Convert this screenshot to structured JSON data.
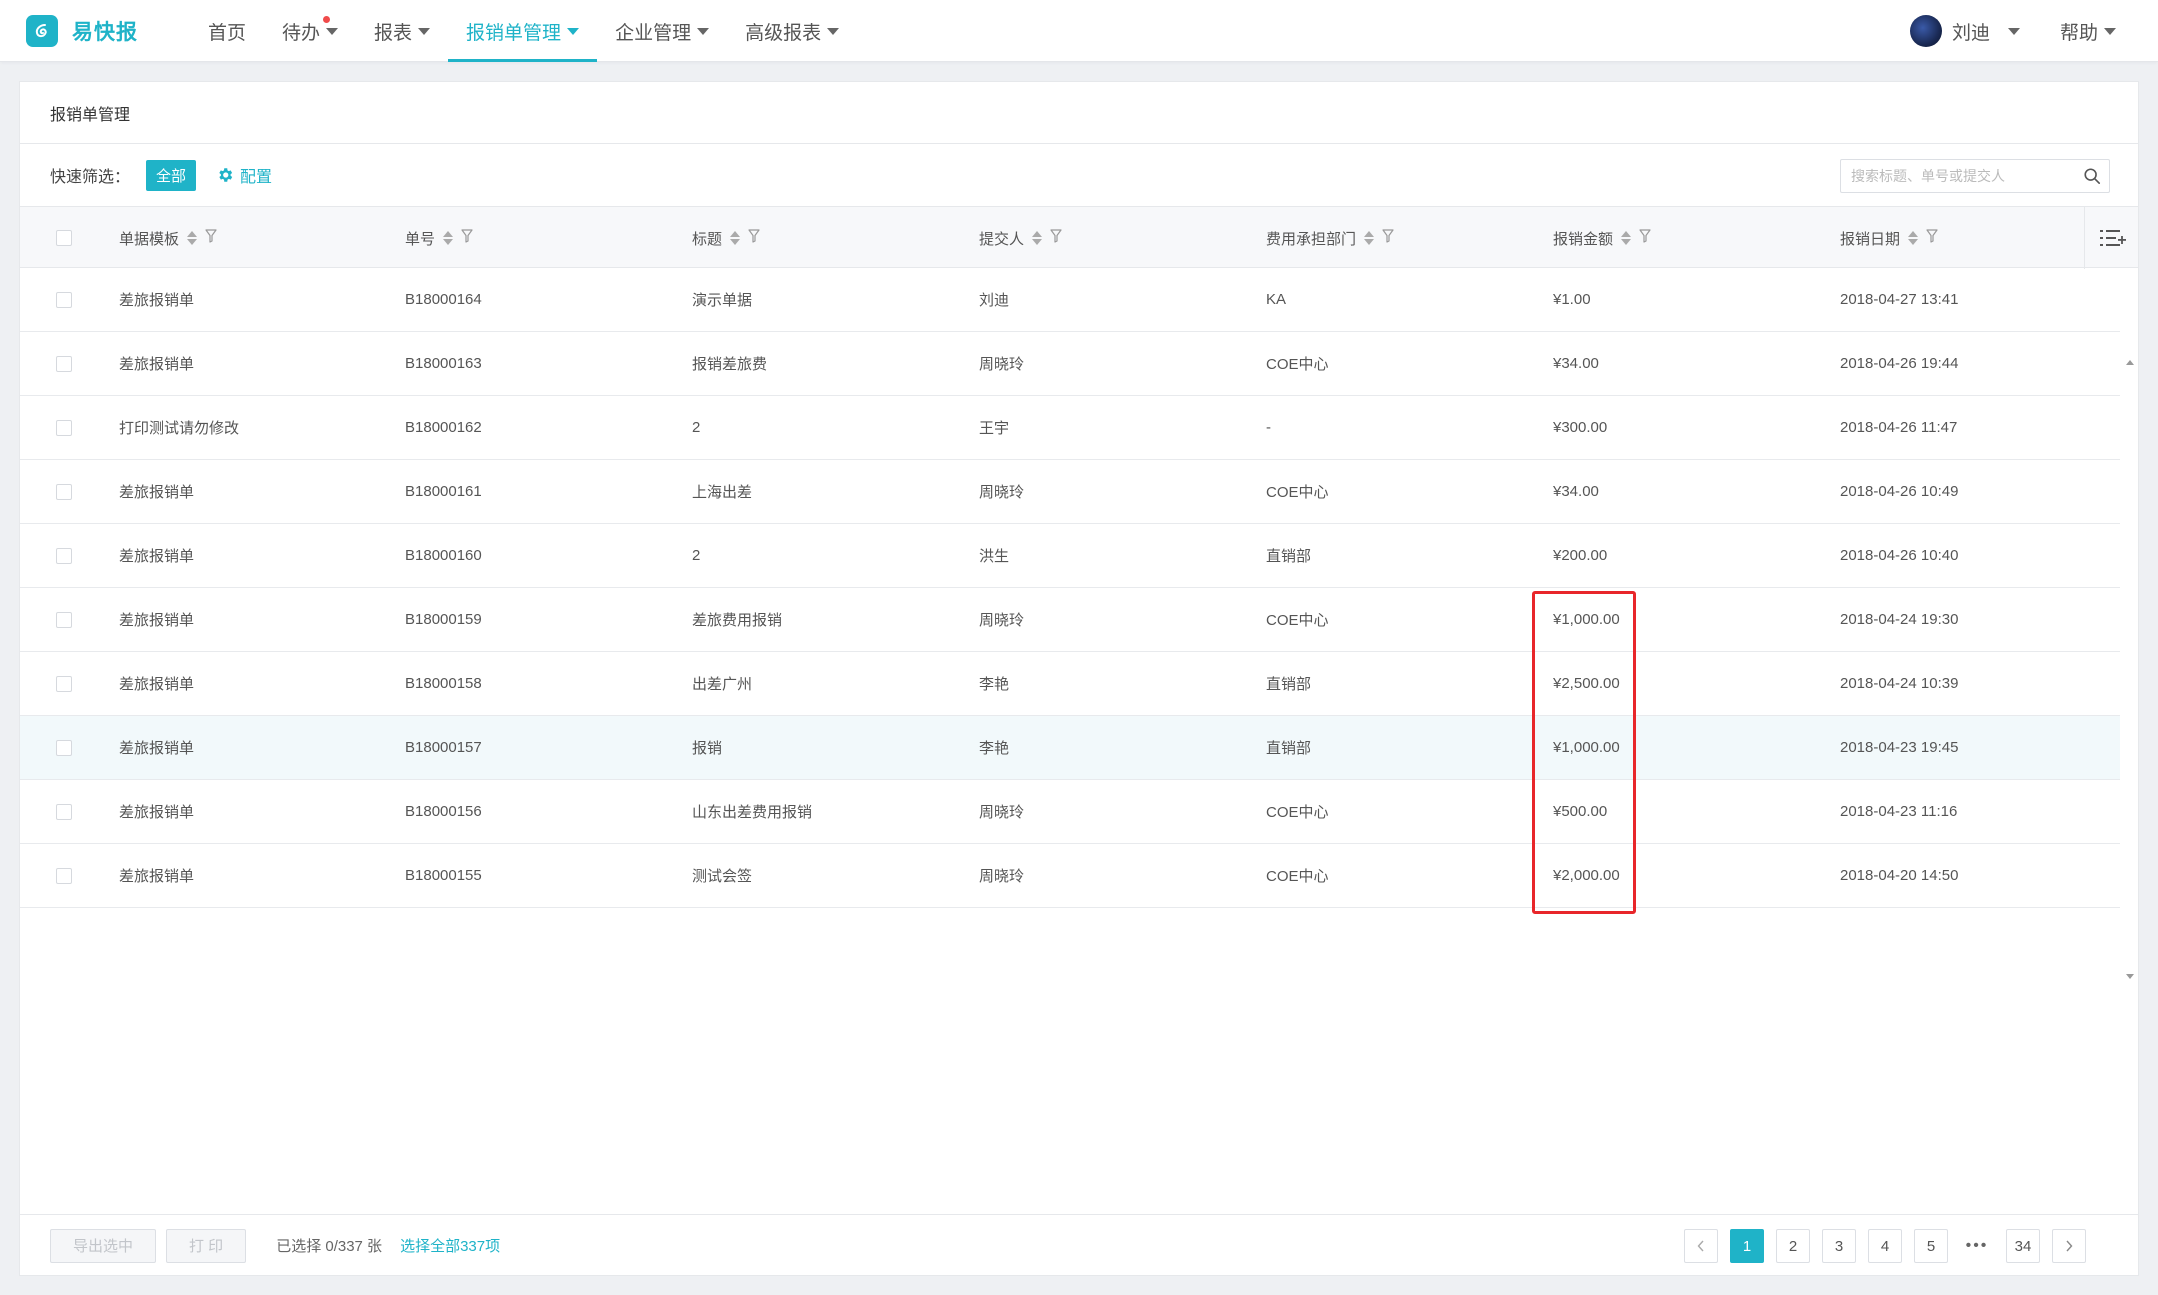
{
  "app": {
    "name": "易快报"
  },
  "nav": {
    "items": [
      {
        "label": "首页",
        "has_caret": false
      },
      {
        "label": "待办",
        "has_caret": true,
        "has_notice": true
      },
      {
        "label": "报表",
        "has_caret": true
      },
      {
        "label": "报销单管理",
        "has_caret": true,
        "active": true
      },
      {
        "label": "企业管理",
        "has_caret": true
      },
      {
        "label": "高级报表",
        "has_caret": true
      }
    ]
  },
  "user": {
    "name": "刘迪"
  },
  "help": {
    "label": "帮助"
  },
  "panel": {
    "title": "报销单管理"
  },
  "filter": {
    "label": "快速筛选：",
    "all_label": "全部",
    "config_label": "配置",
    "search_placeholder": "搜索标题、单号或提交人"
  },
  "table": {
    "columns": [
      "单据模板",
      "单号",
      "标题",
      "提交人",
      "费用承担部门",
      "报销金额",
      "报销日期"
    ],
    "rows": [
      [
        "差旅报销单",
        "B18000164",
        "演示单据",
        "刘迪",
        "KA",
        "¥1.00",
        "2018-04-27 13:41"
      ],
      [
        "差旅报销单",
        "B18000163",
        "报销差旅费",
        "周晓玲",
        "COE中心",
        "¥34.00",
        "2018-04-26 19:44"
      ],
      [
        "打印测试请勿修改",
        "B18000162",
        "2",
        "王宇",
        "-",
        "¥300.00",
        "2018-04-26 11:47"
      ],
      [
        "差旅报销单",
        "B18000161",
        "上海出差",
        "周晓玲",
        "COE中心",
        "¥34.00",
        "2018-04-26 10:49"
      ],
      [
        "差旅报销单",
        "B18000160",
        "2",
        "洪生",
        "直销部",
        "¥200.00",
        "2018-04-26 10:40"
      ],
      [
        "差旅报销单",
        "B18000159",
        "差旅费用报销",
        "周晓玲",
        "COE中心",
        "¥1,000.00",
        "2018-04-24 19:30"
      ],
      [
        "差旅报销单",
        "B18000158",
        "出差广州",
        "李艳",
        "直销部",
        "¥2,500.00",
        "2018-04-24 10:39"
      ],
      [
        "差旅报销单",
        "B18000157",
        "报销",
        "李艳",
        "直销部",
        "¥1,000.00",
        "2018-04-23 19:45"
      ],
      [
        "差旅报销单",
        "B18000156",
        "山东出差费用报销",
        "周晓玲",
        "COE中心",
        "¥500.00",
        "2018-04-23 11:16"
      ],
      [
        "差旅报销单",
        "B18000155",
        "测试会签",
        "周晓玲",
        "COE中心",
        "¥2,000.00",
        "2018-04-20 14:50"
      ]
    ],
    "highlighted_row": 7
  },
  "footer": {
    "export_label": "导出选中",
    "print_label": "打 印",
    "selection_info": "已选择 0/337 张",
    "select_all_label": "选择全部337项",
    "pages": [
      "1",
      "2",
      "3",
      "4",
      "5",
      "•••",
      "34"
    ],
    "current_page": "1"
  },
  "colors": {
    "accent": "#1fb3c8",
    "highlight_box": "#e8262a",
    "notice": "#f04b4b"
  }
}
